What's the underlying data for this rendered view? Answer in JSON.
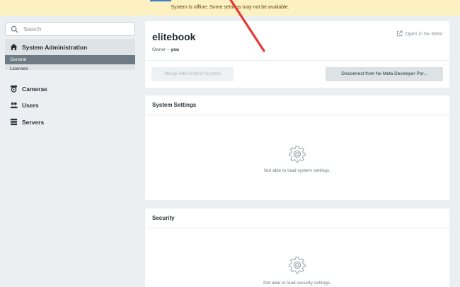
{
  "banner": {
    "text": "System is offline. Some settings may not be available."
  },
  "sidebar": {
    "search_placeholder": "Search",
    "system_admin": {
      "label": "System Administration",
      "sub_items": [
        "General",
        "Licenses"
      ],
      "selected": "General"
    },
    "items": [
      {
        "label": "Cameras",
        "icon": "camera-icon"
      },
      {
        "label": "Users",
        "icon": "users-icon"
      },
      {
        "label": "Servers",
        "icon": "servers-icon"
      }
    ]
  },
  "system_card": {
    "name": "elitebook",
    "owner_prefix": "Owner – ",
    "owner": "you",
    "open_link": "Open in Nx Meta",
    "merge_button": "Merge with Another System",
    "disconnect_button": "Disconnect from Nx Meta Developer Por..."
  },
  "settings_card": {
    "title": "System Settings",
    "message": "Not able to load system settings."
  },
  "security_card": {
    "title": "Security",
    "message": "Not able to load security settings."
  },
  "colors": {
    "banner_bg": "#fdf0c1",
    "selected_bg": "#6c7b84",
    "annotation_arrow": "#e53935"
  }
}
